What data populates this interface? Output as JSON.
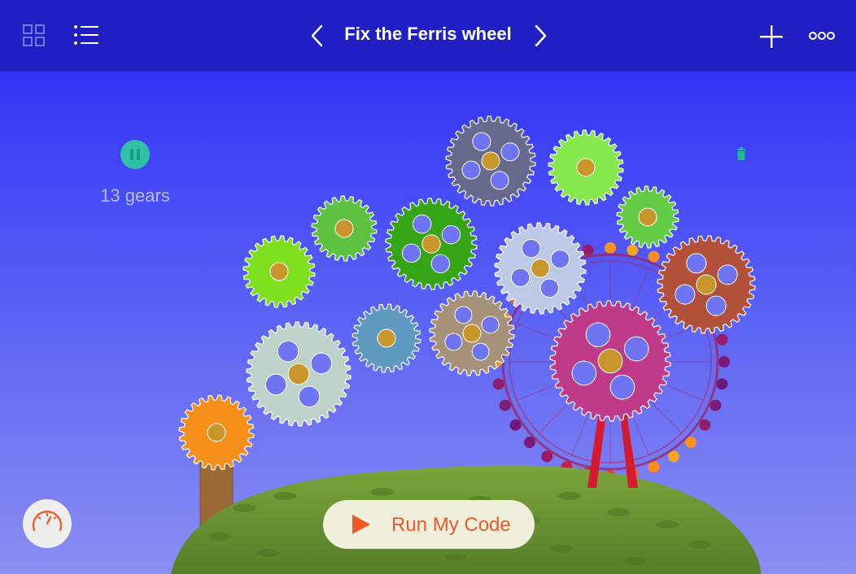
{
  "app": {
    "title": "Fix the Ferris wheel",
    "toolbar": {
      "left_icons": [
        "grid-icon",
        "list-icon"
      ],
      "nav": [
        "chevron-left-icon",
        "chevron-right-icon"
      ],
      "right_icons": [
        "plus-icon",
        "more-icon"
      ],
      "prev_glyph": "‹",
      "next_glyph": "›"
    }
  },
  "scene": {
    "gear_count_label": "13 gears",
    "pause_icon": "pause-icon",
    "trash_icon": "trash-icon",
    "speed_icon": "speedometer-icon",
    "run_button_label": "Run My Code",
    "colors": {
      "topbar": "#1f1fc4",
      "sky_top": "#3334f6",
      "sky_bottom": "#8b8ff2",
      "hill": "#6f9a34",
      "hub": "#c8962a",
      "run_text": "#ea5a2a"
    },
    "gears": [
      {
        "id": "orange",
        "color": "#f6901a",
        "holes": 0
      },
      {
        "id": "lime-left",
        "color": "#7ee01e",
        "holes": 0
      },
      {
        "id": "green-small",
        "color": "#5dc240",
        "holes": 0
      },
      {
        "id": "green-dark",
        "color": "#35a516",
        "holes": 4
      },
      {
        "id": "slate",
        "color": "#676a8c",
        "holes": 4
      },
      {
        "id": "light-green",
        "color": "#86e84a",
        "holes": 0
      },
      {
        "id": "green-right",
        "color": "#63cc44",
        "holes": 0
      },
      {
        "id": "pale-sage",
        "color": "#bdd2c9",
        "holes": 4
      },
      {
        "id": "teal",
        "color": "#5e9ac0",
        "holes": 0
      },
      {
        "id": "tan",
        "color": "#a69278",
        "holes": 4
      },
      {
        "id": "periwinkle",
        "color": "#bccae8",
        "holes": 4
      },
      {
        "id": "rust",
        "color": "#b3503a",
        "holes": 4
      },
      {
        "id": "magenta",
        "color": "#c03a8a",
        "holes": 4
      }
    ]
  }
}
